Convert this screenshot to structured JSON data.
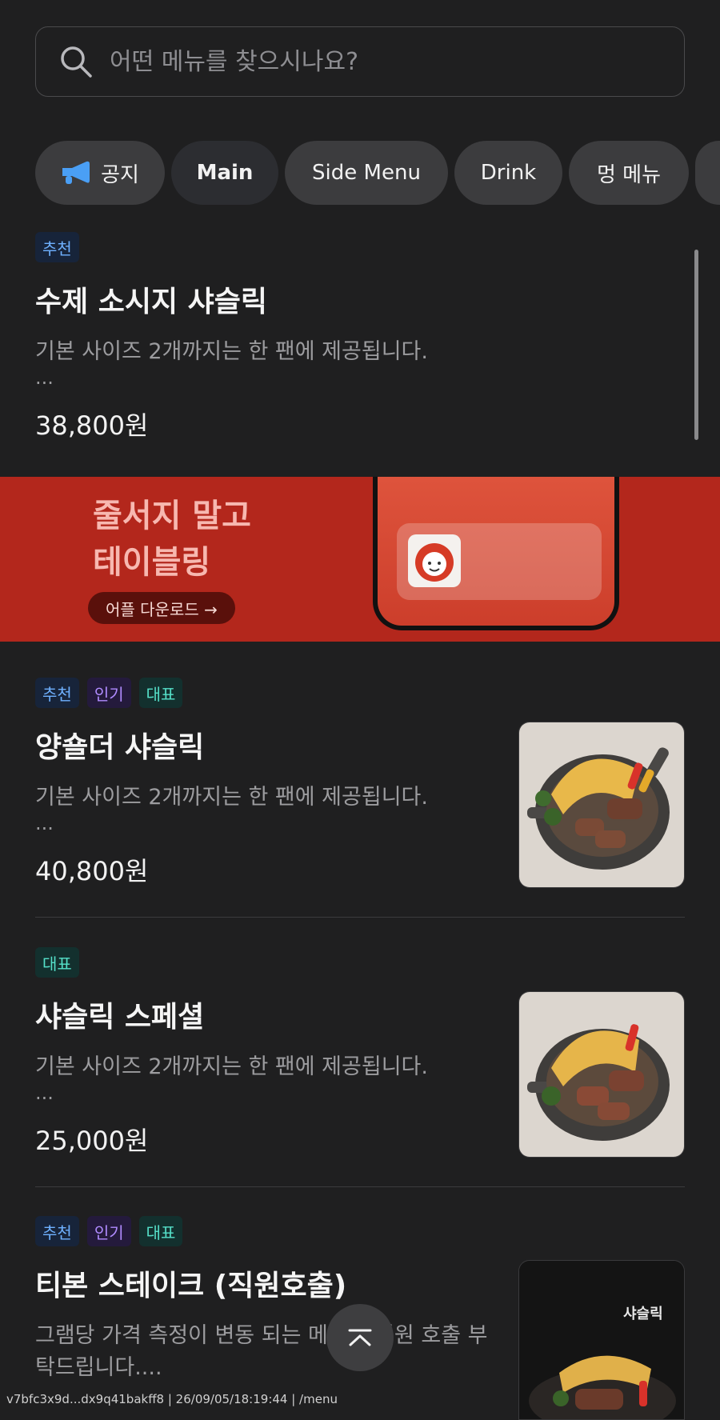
{
  "search": {
    "placeholder": "어떤 메뉴를 찾으시나요?",
    "icon": "search-icon"
  },
  "chips": [
    {
      "label": "공지",
      "icon": "megaphone-icon",
      "active": false
    },
    {
      "label": "Main",
      "active": true
    },
    {
      "label": "Side Menu",
      "active": false
    },
    {
      "label": "Drink",
      "active": false
    },
    {
      "label": "멍 메뉴",
      "active": false
    }
  ],
  "items": [
    {
      "tags": [
        "추천"
      ],
      "title": "수제 소시지 샤슬릭",
      "desc": "기본 사이즈 2개까지는 한 팬에 제공됩니다.",
      "ellipsis": "...",
      "price": "38,800원"
    },
    {
      "tags": [
        "추천",
        "인기",
        "대표"
      ],
      "title": "양숄더 샤슬릭",
      "desc": "기본 사이즈 2개까지는 한 팬에 제공됩니다.",
      "ellipsis": "...",
      "price": "40,800원"
    },
    {
      "tags": [
        "대표"
      ],
      "title": "샤슬릭 스페셜",
      "desc": "기본 사이즈 2개까지는 한 팬에 제공됩니다.",
      "ellipsis": "...",
      "price": "25,000원"
    },
    {
      "tags": [
        "추천",
        "인기",
        "대표"
      ],
      "title": "티본 스테이크 (직원호출)",
      "desc": "그램당 가격 측정이 변동 되는 메뉴로 직원 호출 부탁드립니다....",
      "thumb_text": "샤슬릭"
    }
  ],
  "banner": {
    "line1": "줄서지 말고",
    "line2": "테이블링",
    "button": "어플 다운로드 →"
  },
  "footer": "v7bfc3x9d...dx9q41bakff8 | 26/09/05/18:19:44 | /menu",
  "colors": {
    "background": "#1f1f20",
    "banner": "#b3271c",
    "tag_blue": "#6fb1ff",
    "tag_purple": "#b08bff",
    "tag_teal": "#55e0c9"
  }
}
